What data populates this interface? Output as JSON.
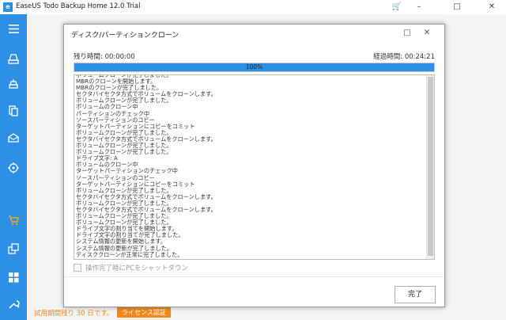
{
  "app": {
    "logo_glyph": "e",
    "title": "EaseUS Todo Backup Home 12.0 Trial",
    "cart_glyph": "🛒",
    "controls": {
      "minimize": "–",
      "maximize": "□",
      "close": "✕"
    }
  },
  "sidebar": {
    "icons": [
      "menu-icon",
      "backup-drive-icon",
      "disk-backup-icon",
      "files-icon",
      "mail-icon",
      "target-icon",
      "cart-icon",
      "clone-icon",
      "apps-icon",
      "tools-icon"
    ]
  },
  "trial": {
    "text": "試用期間残り 30 日です。",
    "license_button": "ライセンス認証"
  },
  "dialog": {
    "title": "ディスク/パーティションクローン",
    "controls": {
      "maximize": "□",
      "close": "✕"
    },
    "remaining_label": "残り時間:  00:00:00",
    "elapsed_label": "経過時間:  00:24:21",
    "progress_percent": 100,
    "progress_text": "100%",
    "log_lines": [
      "ボリュームクローンが完了しました。",
      "MBRのクローンを開始します。",
      "MBRのクローンが完了しました。",
      "セクタバイセクタ方式でボリュームをクローンします。",
      "ボリュームクローンが完了しました。",
      "ボリュームのクローン中",
      "パーティションのチェック中",
      "ソースパーティションのコピー",
      "ターゲットパーティションにコピーをコミット",
      "ボリュームクローンが完了しました。",
      "セクタバイセクタ方式でボリュームをクローンします。",
      "ボリュームクローンが完了しました。",
      "ボリュームクローンが完了しました。",
      "ドライブ文字: A",
      "ボリュームのクローン中",
      "ターゲットパーティションのチェック中",
      "ソースパーティションのコピー",
      "ターゲットパーティションにコピーをコミット",
      "ボリュームクローンが完了しました。",
      "セクタバイセクタ方式でボリュームをクローンします。",
      "ボリュームクローンが完了しました。",
      "セクタバイセクタ方式でボリュームをクローンします。",
      "ボリュームクローンが完了しました。",
      "ボリュームクローンが完了しました。",
      "ドライブ文字の割り当てを開始します。",
      "ドライブ文字の割り当てが完了しました。",
      "システム情報の更新を開始します。",
      "システム情報の更新が完了しました。",
      "ディスククローンが正常に完了しました。"
    ],
    "shutdown_label": "操作完了時にPCをシャットダウン",
    "finish_button": "完了"
  }
}
